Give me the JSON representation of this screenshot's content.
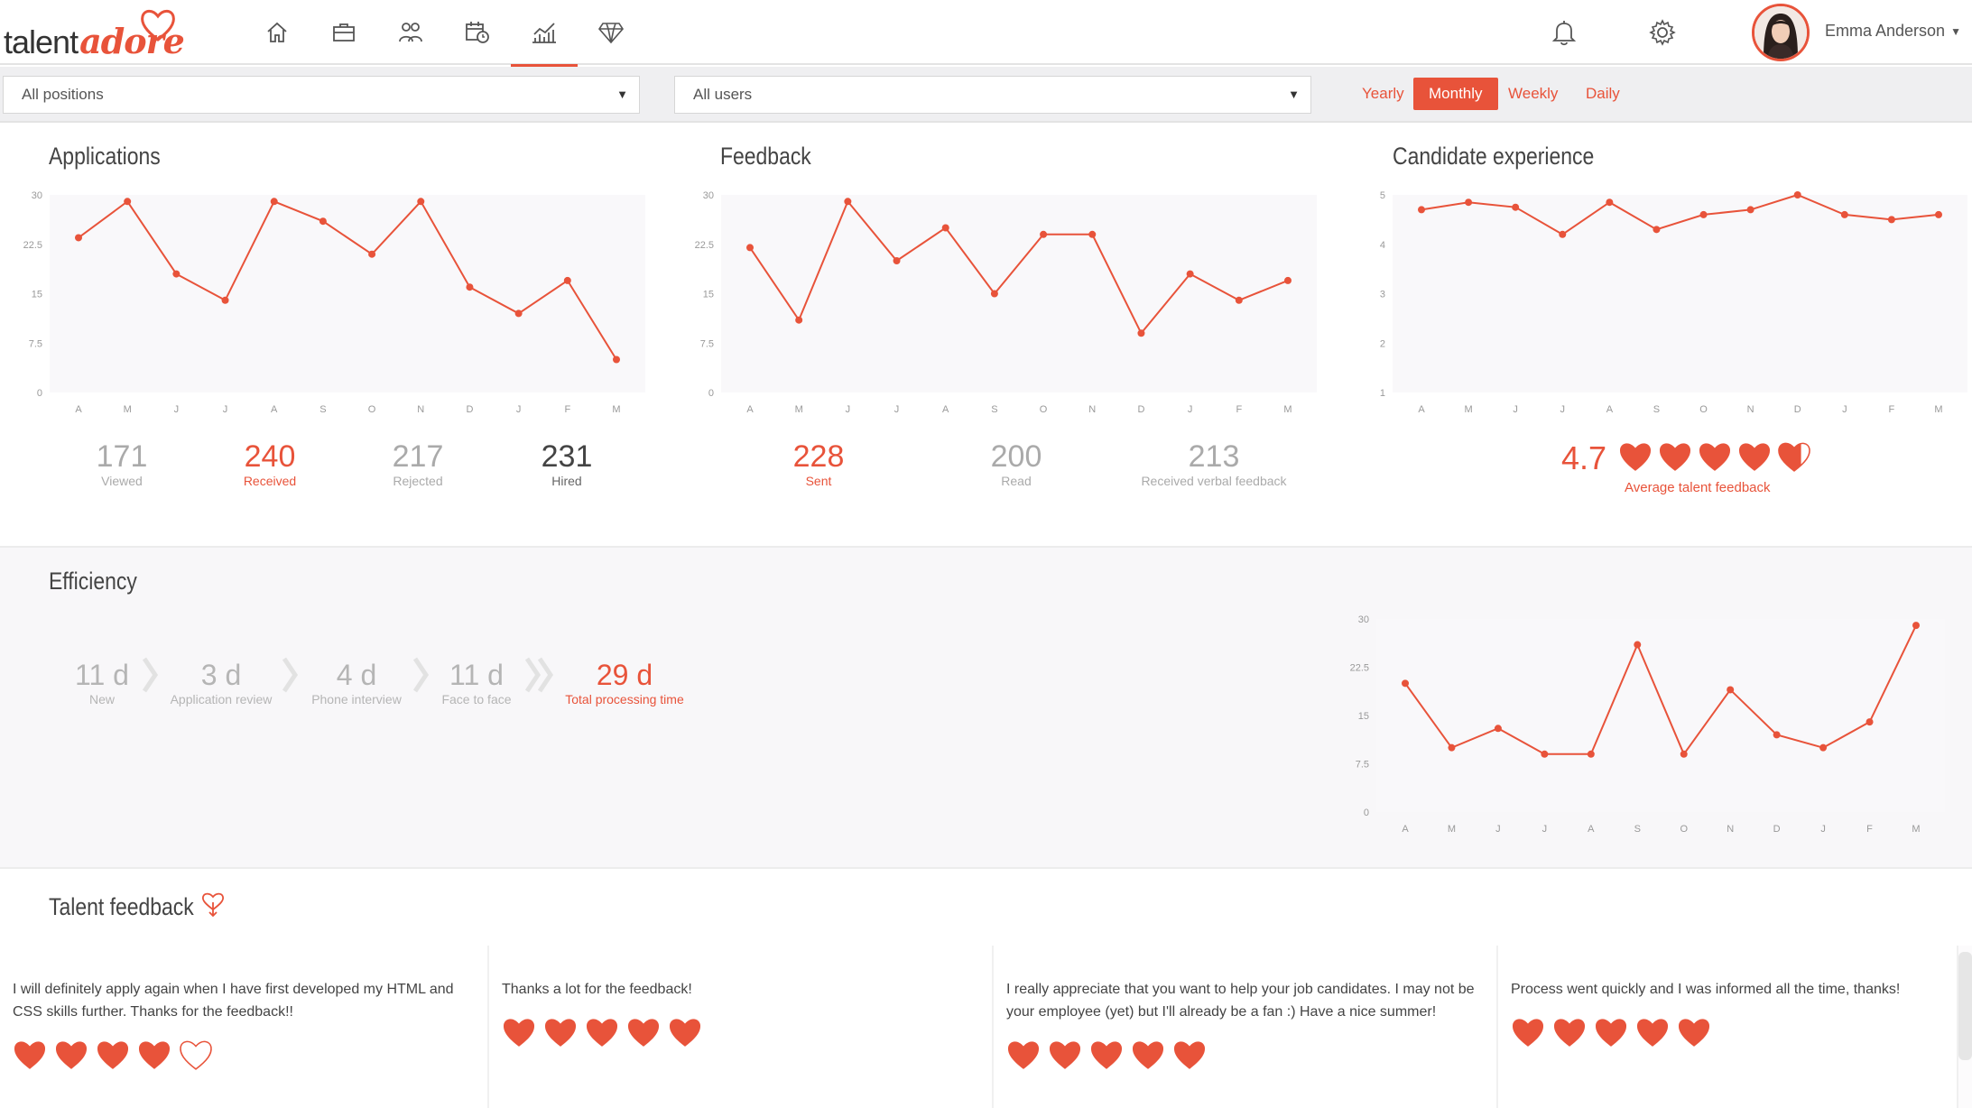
{
  "brand": {
    "talent": "talent",
    "adore": "adore",
    "accent": "#e8533a"
  },
  "nav": {
    "items": [
      {
        "name": "home-icon"
      },
      {
        "name": "briefcase-icon"
      },
      {
        "name": "people-icon"
      },
      {
        "name": "calendar-clock-icon"
      },
      {
        "name": "analytics-icon",
        "active": true
      },
      {
        "name": "diamond-icon"
      }
    ]
  },
  "header": {
    "username": "Emma Anderson"
  },
  "filters": {
    "positions": "All positions",
    "users": "All users",
    "periods": [
      "Yearly",
      "Monthly",
      "Weekly",
      "Daily"
    ],
    "active_period": "Monthly"
  },
  "applications": {
    "title": "Applications",
    "stats": [
      {
        "value": "171",
        "label": "Viewed"
      },
      {
        "value": "240",
        "label": "Received"
      },
      {
        "value": "217",
        "label": "Rejected"
      },
      {
        "value": "231",
        "label": "Hired"
      }
    ]
  },
  "feedback": {
    "title": "Feedback",
    "stats": [
      {
        "value": "228",
        "label": "Sent"
      },
      {
        "value": "200",
        "label": "Read"
      },
      {
        "value": "213",
        "label": "Received verbal feedback"
      }
    ]
  },
  "candidate_experience": {
    "title": "Candidate experience",
    "score": "4.7",
    "score_label": "Average talent feedback",
    "hearts": 4.7
  },
  "efficiency": {
    "title": "Efficiency",
    "steps": [
      {
        "value": "11 d",
        "label": "New"
      },
      {
        "value": "3 d",
        "label": "Application review"
      },
      {
        "value": "4 d",
        "label": "Phone interview"
      },
      {
        "value": "11 d",
        "label": "Face to face"
      },
      {
        "value": "29 d",
        "label": "Total processing time"
      }
    ]
  },
  "talent_feedback": {
    "title": "Talent feedback",
    "cards": [
      {
        "text": "I will definitely apply again when I have first developed my HTML and CSS skills further. Thanks for the feedback!!",
        "hearts": 4
      },
      {
        "text": "Thanks a lot for the feedback!",
        "hearts": 5
      },
      {
        "text": "I really appreciate that you want to help your job candidates. I may not be your employee (yet) but I'll already be a fan :) Have a nice summer!",
        "hearts": 5
      },
      {
        "text": "Process went quickly and I was informed all the time, thanks!",
        "hearts": 5
      }
    ]
  },
  "chart_data": [
    {
      "type": "line",
      "title": "Applications",
      "categories": [
        "A",
        "M",
        "J",
        "J",
        "A",
        "S",
        "O",
        "N",
        "D",
        "J",
        "F",
        "M"
      ],
      "values": [
        23.5,
        29,
        18,
        14,
        29,
        26,
        21,
        29,
        16,
        12,
        17,
        5
      ],
      "yticks": [
        "0",
        "7.5",
        "15",
        "22.5",
        "30"
      ],
      "ylim": [
        0,
        30
      ]
    },
    {
      "type": "line",
      "title": "Feedback",
      "categories": [
        "A",
        "M",
        "J",
        "J",
        "A",
        "S",
        "O",
        "N",
        "D",
        "J",
        "F",
        "M"
      ],
      "values": [
        22,
        11,
        29,
        20,
        25,
        15,
        24,
        24,
        9,
        18,
        14,
        17
      ],
      "yticks": [
        "0",
        "7.5",
        "15",
        "22.5",
        "30"
      ],
      "ylim": [
        0,
        30
      ]
    },
    {
      "type": "line",
      "title": "Candidate experience",
      "categories": [
        "A",
        "M",
        "J",
        "J",
        "A",
        "S",
        "O",
        "N",
        "D",
        "J",
        "F",
        "M"
      ],
      "values": [
        4.7,
        4.85,
        4.75,
        4.2,
        4.85,
        4.3,
        4.6,
        4.7,
        5.0,
        4.6,
        4.5,
        4.6
      ],
      "yticks": [
        "1",
        "2",
        "3",
        "4",
        "5"
      ],
      "ylim": [
        1,
        5
      ]
    },
    {
      "type": "line",
      "title": "Efficiency",
      "categories": [
        "A",
        "M",
        "J",
        "J",
        "A",
        "S",
        "O",
        "N",
        "D",
        "J",
        "F",
        "M"
      ],
      "values": [
        20,
        10,
        13,
        9,
        9,
        26,
        9,
        19,
        12,
        10,
        14,
        29
      ],
      "yticks": [
        "0",
        "7.5",
        "15",
        "22.5",
        "30"
      ],
      "ylim": [
        0,
        30
      ]
    }
  ]
}
